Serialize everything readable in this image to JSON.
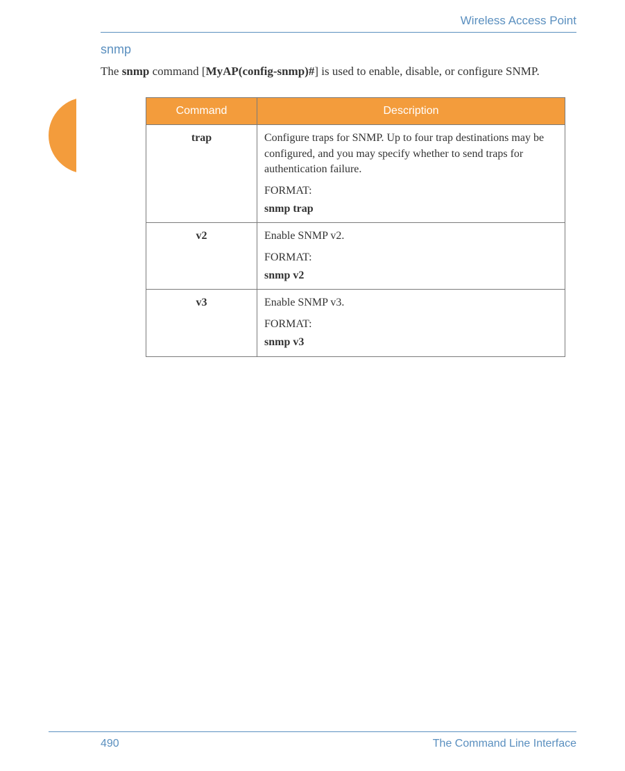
{
  "header": {
    "title": "Wireless Access Point"
  },
  "section": {
    "title": "snmp",
    "intro_pre": "The ",
    "intro_cmd": "snmp",
    "intro_mid": " command [",
    "intro_prompt": "MyAP(config-snmp)#",
    "intro_post": "] is used to enable, disable, or configure SNMP."
  },
  "table": {
    "headers": {
      "col1": "Command",
      "col2": "Description"
    },
    "rows": [
      {
        "command": "trap",
        "desc": "Configure traps for SNMP. Up to four trap destinations may be configured, and you may specify whether to send traps for authentication failure.",
        "format_label": "FORMAT:",
        "format_cmd": "snmp trap"
      },
      {
        "command": "v2",
        "desc": "Enable SNMP v2.",
        "format_label": "FORMAT:",
        "format_cmd": "snmp v2"
      },
      {
        "command": "v3",
        "desc": "Enable SNMP v3.",
        "format_label": "FORMAT:",
        "format_cmd": "snmp v3"
      }
    ]
  },
  "footer": {
    "page_number": "490",
    "section_name": "The Command Line Interface"
  }
}
